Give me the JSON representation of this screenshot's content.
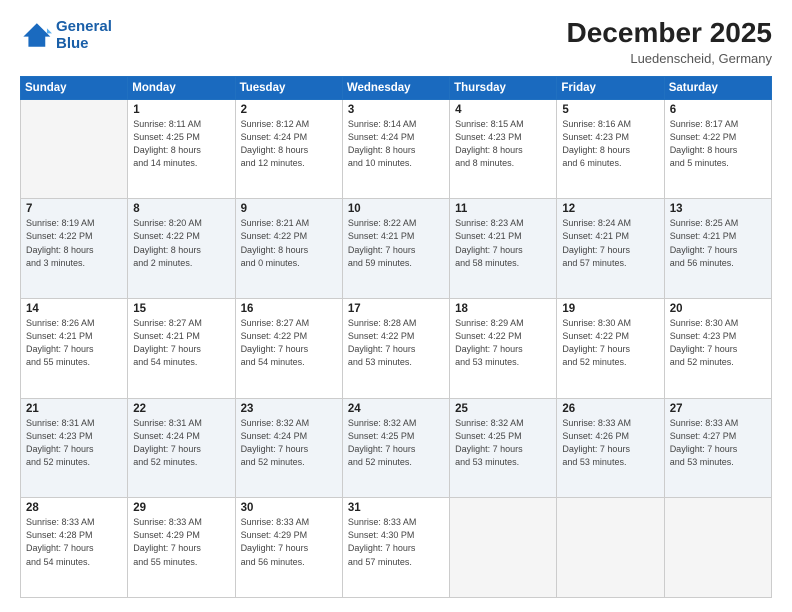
{
  "logo": {
    "line1": "General",
    "line2": "Blue"
  },
  "header": {
    "month_year": "December 2025",
    "location": "Luedenscheid, Germany"
  },
  "weekdays": [
    "Sunday",
    "Monday",
    "Tuesday",
    "Wednesday",
    "Thursday",
    "Friday",
    "Saturday"
  ],
  "weeks": [
    [
      {
        "day": "",
        "info": ""
      },
      {
        "day": "1",
        "info": "Sunrise: 8:11 AM\nSunset: 4:25 PM\nDaylight: 8 hours\nand 14 minutes."
      },
      {
        "day": "2",
        "info": "Sunrise: 8:12 AM\nSunset: 4:24 PM\nDaylight: 8 hours\nand 12 minutes."
      },
      {
        "day": "3",
        "info": "Sunrise: 8:14 AM\nSunset: 4:24 PM\nDaylight: 8 hours\nand 10 minutes."
      },
      {
        "day": "4",
        "info": "Sunrise: 8:15 AM\nSunset: 4:23 PM\nDaylight: 8 hours\nand 8 minutes."
      },
      {
        "day": "5",
        "info": "Sunrise: 8:16 AM\nSunset: 4:23 PM\nDaylight: 8 hours\nand 6 minutes."
      },
      {
        "day": "6",
        "info": "Sunrise: 8:17 AM\nSunset: 4:22 PM\nDaylight: 8 hours\nand 5 minutes."
      }
    ],
    [
      {
        "day": "7",
        "info": "Sunrise: 8:19 AM\nSunset: 4:22 PM\nDaylight: 8 hours\nand 3 minutes."
      },
      {
        "day": "8",
        "info": "Sunrise: 8:20 AM\nSunset: 4:22 PM\nDaylight: 8 hours\nand 2 minutes."
      },
      {
        "day": "9",
        "info": "Sunrise: 8:21 AM\nSunset: 4:22 PM\nDaylight: 8 hours\nand 0 minutes."
      },
      {
        "day": "10",
        "info": "Sunrise: 8:22 AM\nSunset: 4:21 PM\nDaylight: 7 hours\nand 59 minutes."
      },
      {
        "day": "11",
        "info": "Sunrise: 8:23 AM\nSunset: 4:21 PM\nDaylight: 7 hours\nand 58 minutes."
      },
      {
        "day": "12",
        "info": "Sunrise: 8:24 AM\nSunset: 4:21 PM\nDaylight: 7 hours\nand 57 minutes."
      },
      {
        "day": "13",
        "info": "Sunrise: 8:25 AM\nSunset: 4:21 PM\nDaylight: 7 hours\nand 56 minutes."
      }
    ],
    [
      {
        "day": "14",
        "info": "Sunrise: 8:26 AM\nSunset: 4:21 PM\nDaylight: 7 hours\nand 55 minutes."
      },
      {
        "day": "15",
        "info": "Sunrise: 8:27 AM\nSunset: 4:21 PM\nDaylight: 7 hours\nand 54 minutes."
      },
      {
        "day": "16",
        "info": "Sunrise: 8:27 AM\nSunset: 4:22 PM\nDaylight: 7 hours\nand 54 minutes."
      },
      {
        "day": "17",
        "info": "Sunrise: 8:28 AM\nSunset: 4:22 PM\nDaylight: 7 hours\nand 53 minutes."
      },
      {
        "day": "18",
        "info": "Sunrise: 8:29 AM\nSunset: 4:22 PM\nDaylight: 7 hours\nand 53 minutes."
      },
      {
        "day": "19",
        "info": "Sunrise: 8:30 AM\nSunset: 4:22 PM\nDaylight: 7 hours\nand 52 minutes."
      },
      {
        "day": "20",
        "info": "Sunrise: 8:30 AM\nSunset: 4:23 PM\nDaylight: 7 hours\nand 52 minutes."
      }
    ],
    [
      {
        "day": "21",
        "info": "Sunrise: 8:31 AM\nSunset: 4:23 PM\nDaylight: 7 hours\nand 52 minutes."
      },
      {
        "day": "22",
        "info": "Sunrise: 8:31 AM\nSunset: 4:24 PM\nDaylight: 7 hours\nand 52 minutes."
      },
      {
        "day": "23",
        "info": "Sunrise: 8:32 AM\nSunset: 4:24 PM\nDaylight: 7 hours\nand 52 minutes."
      },
      {
        "day": "24",
        "info": "Sunrise: 8:32 AM\nSunset: 4:25 PM\nDaylight: 7 hours\nand 52 minutes."
      },
      {
        "day": "25",
        "info": "Sunrise: 8:32 AM\nSunset: 4:25 PM\nDaylight: 7 hours\nand 53 minutes."
      },
      {
        "day": "26",
        "info": "Sunrise: 8:33 AM\nSunset: 4:26 PM\nDaylight: 7 hours\nand 53 minutes."
      },
      {
        "day": "27",
        "info": "Sunrise: 8:33 AM\nSunset: 4:27 PM\nDaylight: 7 hours\nand 53 minutes."
      }
    ],
    [
      {
        "day": "28",
        "info": "Sunrise: 8:33 AM\nSunset: 4:28 PM\nDaylight: 7 hours\nand 54 minutes."
      },
      {
        "day": "29",
        "info": "Sunrise: 8:33 AM\nSunset: 4:29 PM\nDaylight: 7 hours\nand 55 minutes."
      },
      {
        "day": "30",
        "info": "Sunrise: 8:33 AM\nSunset: 4:29 PM\nDaylight: 7 hours\nand 56 minutes."
      },
      {
        "day": "31",
        "info": "Sunrise: 8:33 AM\nSunset: 4:30 PM\nDaylight: 7 hours\nand 57 minutes."
      },
      {
        "day": "",
        "info": ""
      },
      {
        "day": "",
        "info": ""
      },
      {
        "day": "",
        "info": ""
      }
    ]
  ]
}
